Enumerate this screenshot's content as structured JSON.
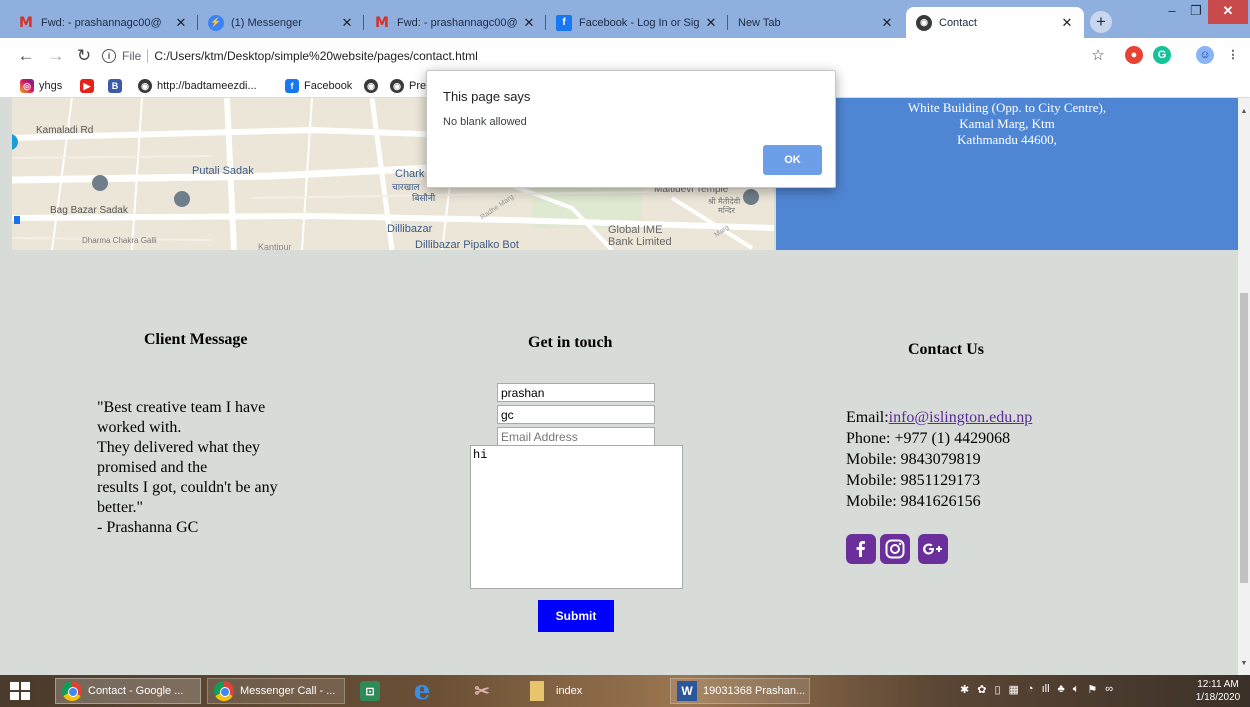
{
  "browser": {
    "tabs": [
      {
        "title": "Fwd: - prashannagc00@",
        "icon": "gmail-icon",
        "active": false
      },
      {
        "title": "(1) Messenger",
        "icon": "messenger-icon",
        "active": false
      },
      {
        "title": "Fwd: - prashannagc00@",
        "icon": "gmail-icon",
        "active": false
      },
      {
        "title": "Facebook - Log In or Sig",
        "icon": "facebook-icon",
        "active": false
      },
      {
        "title": "New Tab",
        "icon": "",
        "active": false
      },
      {
        "title": "Contact",
        "icon": "globe-icon",
        "active": true
      }
    ],
    "new_tab": "+",
    "address": {
      "scheme_label": "File",
      "url": "C:/Users/ktm/Desktop/simple%20website/pages/contact.html"
    },
    "bookmarks": [
      "yhgs",
      "http://badtameezdi...",
      "Facebook",
      "Pre"
    ]
  },
  "page": {
    "address_lines": [
      "White Building (Opp. to City Centre),",
      "Kamal Marg, Ktm",
      "Kathmandu 44600,"
    ],
    "map_labels": {
      "kamaladi": "Kamaladi Rd",
      "putali": "Putali Sadak",
      "bagbazar": "Bag Bazar Sadak",
      "dharma": "Dharma Chakra Galli",
      "chark": "Chark",
      "chark_np": "चारखाल",
      "bisauni": "बिसौनी",
      "maitidevi": "Maitidevi Temple",
      "maitidevi_np1": "श्री मैतीदेवी",
      "maitidevi_np2": "मन्दिर",
      "dillibazar": "Dillibazar",
      "dillibazar_pipalko": "Dillibazar Pipalko Bot",
      "global_ime1": "Global IME",
      "global_ime2": "Bank Limited",
      "kantipur": "Kantipur",
      "radhe": "Radhe Marg",
      "marg": "Marg"
    },
    "client_message": {
      "heading": "Client Message",
      "lines": [
        "\"Best creative team I have",
        "worked with.",
        "They delivered what they",
        "promised and the",
        "results I got, couldn't be any",
        "better.\"",
        "- Prashanna GC"
      ]
    },
    "get_in_touch": {
      "heading": "Get in touch",
      "first_name": "prashan",
      "last_name": "gc",
      "email_placeholder": "Email Address",
      "message": "hi",
      "submit": "Submit"
    },
    "contact_us": {
      "heading": "Contact Us",
      "email_label": "Email:",
      "email": "info@islington.edu.np",
      "phone": "Phone: +977 (1) 4429068",
      "mobiles": [
        "Mobile: 9843079819",
        "Mobile: 9851129173",
        "Mobile: 9841626156"
      ],
      "social": [
        "facebook-icon",
        "instagram-icon",
        "google-plus-icon"
      ]
    }
  },
  "alert": {
    "title": "This page says",
    "message": "No blank allowed",
    "ok": "OK"
  },
  "taskbar": {
    "items": [
      "Contact - Google ...",
      "Messenger Call - ...",
      "index",
      "19031368 Prashan..."
    ],
    "time": "12:11 AM",
    "date": "1/18/2020"
  },
  "colors": {
    "page_bg": "#d8dcd8",
    "address_box": "#4f86d4",
    "submit": "#0000ff",
    "social": "#6a2f9b",
    "alert_ok": "#6d9ee8"
  }
}
